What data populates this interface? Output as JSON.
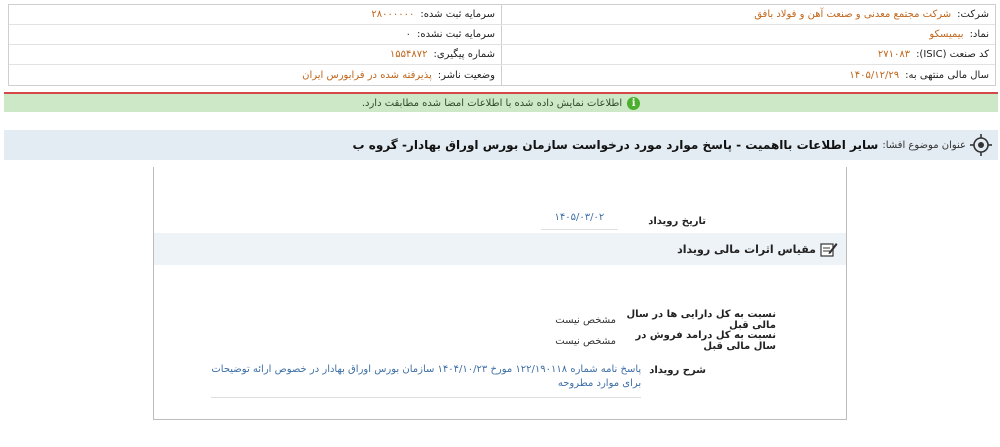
{
  "company_info": {
    "company_label": "شرکت:",
    "company_value": "شرکت مجتمع معدنی و صنعت آهن و فولاد بافق",
    "registered_capital_label": "سرمایه ثبت شده:",
    "registered_capital_value": "۲۸۰۰۰۰۰۰",
    "symbol_label": "نماد:",
    "symbol_value": "بیمیسکو",
    "unregistered_capital_label": "سرمایه ثبت نشده:",
    "unregistered_capital_value": "۰",
    "isic_label": "کد صنعت (ISIC):",
    "isic_value": "۲۷۱۰۸۳",
    "tracking_label": "شماره پیگیری:",
    "tracking_value": "۱۵۵۴۸۷۲",
    "fiscal_year_label": "سال مالی منتهی به:",
    "fiscal_year_value": "۱۴۰۵/۱۲/۲۹",
    "publisher_status_label": "وضعیت ناشر:",
    "publisher_status_value": "پذیرفته شده در فرابورس ایران"
  },
  "notice": {
    "text": "اطلاعات نمایش داده شده با اطلاعات امضا شده مطابقت دارد.",
    "icon": "info-icon",
    "color": "#4caf2e"
  },
  "subject": {
    "label": "عنوان موضوع افشا:",
    "title": "سایر اطلاعات بااهمیت - پاسخ موارد مورد درخواست سازمان بورس اوراق بهادار- گروه ب"
  },
  "event": {
    "date_label": "تاریخ رویداد",
    "date_value": "۱۴۰۵/۰۳/۰۲",
    "section_title": "مقیاس اثرات مالی رویداد",
    "metrics": [
      {
        "label": "نسبت به کل دارایی ها در سال مالی قبل",
        "value": "مشخص نیست"
      },
      {
        "label": "نسبت به کل درامد فروش در سال مالی قبل",
        "value": "مشخص نیست"
      }
    ],
    "description_label": "شرح رویداد",
    "description_value": "پاسخ نامه شماره ۱۲۲/۱۹۰۱۱۸ مورخ ۱۴۰۴/۱۰/۲۳ سازمان بورس اوراق بهادار در خصوص ارائه توضیحات برای موارد مطروحه"
  }
}
